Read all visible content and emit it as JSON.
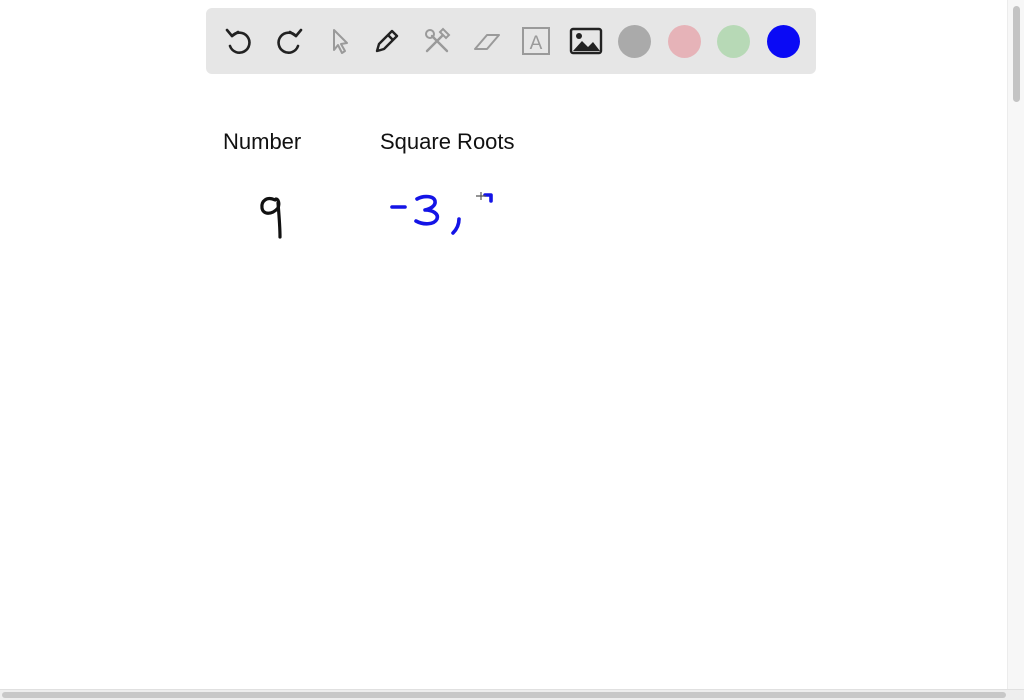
{
  "toolbar": {
    "tools": [
      {
        "name": "undo-icon",
        "enabled": true
      },
      {
        "name": "redo-icon",
        "enabled": true
      },
      {
        "name": "pointer-icon",
        "enabled": false
      },
      {
        "name": "pen-icon",
        "enabled": true
      },
      {
        "name": "tools-icon",
        "enabled": false
      },
      {
        "name": "eraser-icon",
        "enabled": false
      },
      {
        "name": "text-icon",
        "enabled": false
      },
      {
        "name": "image-icon",
        "enabled": true
      }
    ],
    "text_tool_glyph": "A",
    "colors": {
      "gray": "#aaaaaa",
      "pink": "#e6b3b8",
      "green": "#b7d9b6",
      "blue": "#0a0af5"
    },
    "selected_color": "blue"
  },
  "canvas": {
    "header_number": "Number",
    "header_square_roots": "Square Roots"
  },
  "ink": {
    "black": "#111111",
    "blue": "#1414e6"
  }
}
